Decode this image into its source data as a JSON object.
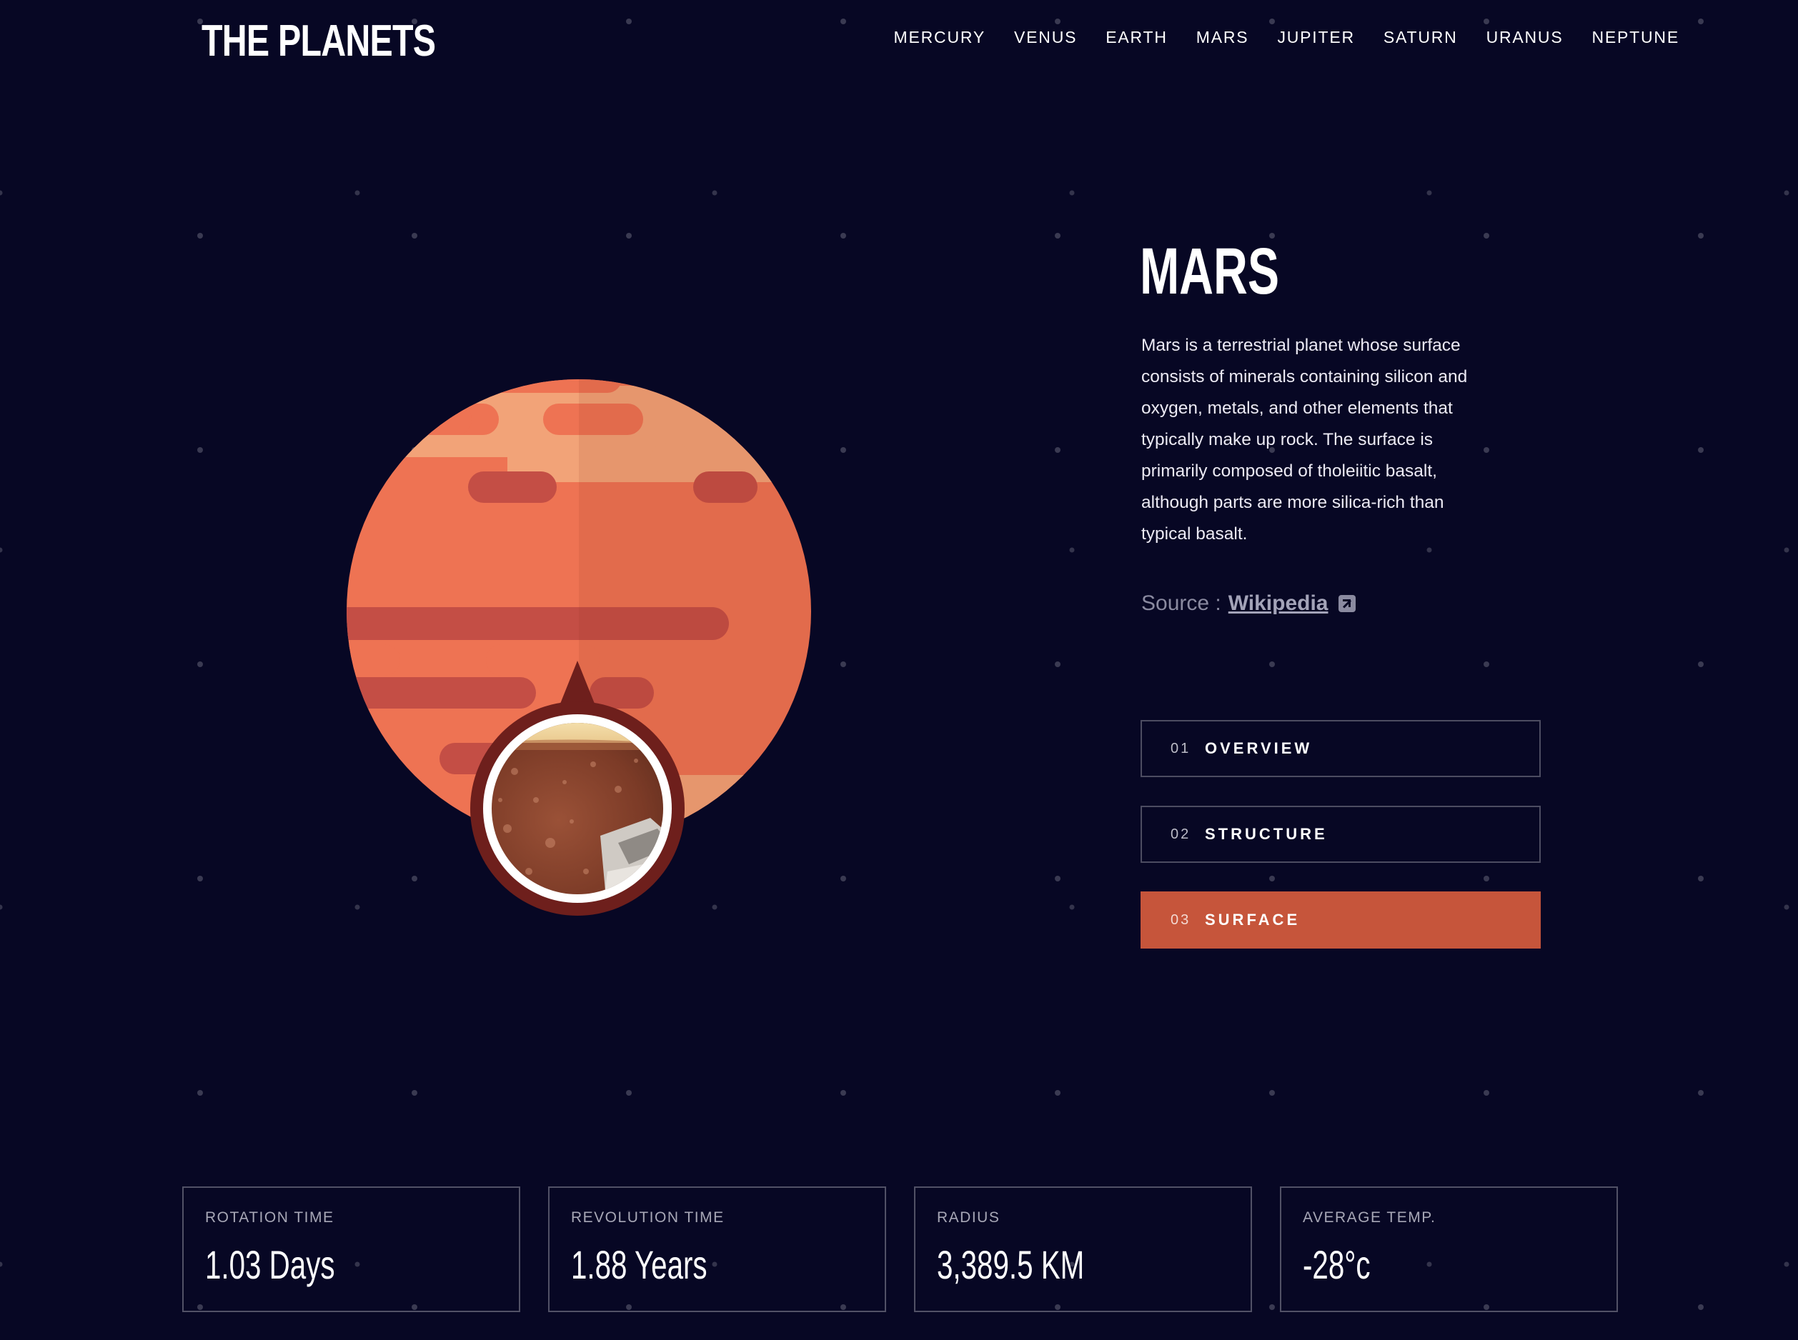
{
  "brand": {
    "logo_text": "THE PLANETS"
  },
  "nav": {
    "items": [
      {
        "label": "MERCURY",
        "name": "nav-item-mercury"
      },
      {
        "label": "VENUS",
        "name": "nav-item-venus"
      },
      {
        "label": "EARTH",
        "name": "nav-item-earth"
      },
      {
        "label": "MARS",
        "name": "nav-item-mars"
      },
      {
        "label": "JUPITER",
        "name": "nav-item-jupiter"
      },
      {
        "label": "SATURN",
        "name": "nav-item-saturn"
      },
      {
        "label": "URANUS",
        "name": "nav-item-uranus"
      },
      {
        "label": "NEPTUNE",
        "name": "nav-item-neptune"
      }
    ]
  },
  "planet": {
    "name": "MARS",
    "description": "Mars is a terrestrial planet whose surface consists of minerals containing silicon and oxygen, metals, and other elements that typically make up rock. The surface is primarily composed of tholeiitic basalt, although parts are more silica-rich than typical basalt.",
    "source_label": "Source :",
    "source_link": "Wikipedia",
    "illustration_icon": "mars-planet-illustration",
    "surface_image_icon": "mars-surface-photo"
  },
  "tabs": [
    {
      "num": "01",
      "label": "OVERVIEW",
      "active": false
    },
    {
      "num": "02",
      "label": "STRUCTURE",
      "active": false
    },
    {
      "num": "03",
      "label": "SURFACE",
      "active": true
    }
  ],
  "stats": [
    {
      "label": "ROTATION TIME",
      "value": "1.03 Days"
    },
    {
      "label": "REVOLUTION TIME",
      "value": "1.88 Years"
    },
    {
      "label": "RADIUS",
      "value": "3,389.5 KM"
    },
    {
      "label": "AVERAGE TEMP.",
      "value": "-28°c"
    }
  ],
  "colors": {
    "background": "#070724",
    "accent": "#C6553B",
    "planet_base": "#EE7353",
    "planet_shadow": "#D96B4F",
    "planet_light": "#F2A378",
    "planet_dark": "#C44E45",
    "surface_ring": "#6E1F1C"
  }
}
